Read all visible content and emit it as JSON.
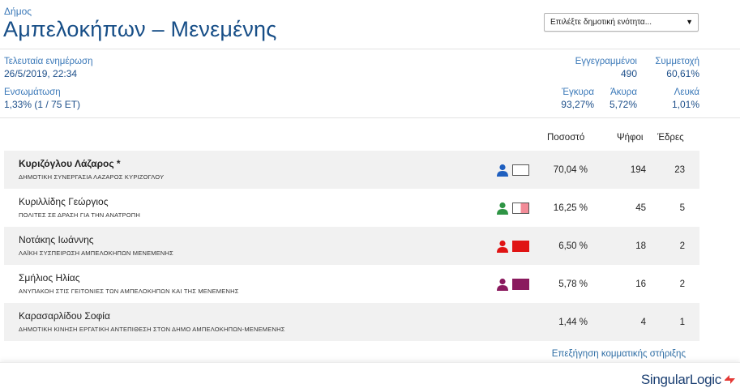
{
  "header": {
    "kicker": "Δήμος",
    "title": "Αμπελοκήπων – Μενεμένης",
    "select": {
      "value": "Επιλέξτε δημοτική ενότητα...",
      "caret": "▼"
    }
  },
  "meta": {
    "updated_label": "Τελευταία ενημέρωση",
    "updated_value": "26/5/2019, 22:34",
    "integration_label": "Ενσωμάτωση",
    "integration_value": "1,33% (1 / 75 ΕΤ)",
    "registered_label": "Εγγεγραμμένοι",
    "registered_value": "490",
    "turnout_label": "Συμμετοχή",
    "turnout_value": "60,61%",
    "valid_label": "Έγκυρα",
    "valid_value": "93,27%",
    "invalid_label": "Άκυρα",
    "invalid_value": "5,72%",
    "blank_label": "Λευκά",
    "blank_value": "1,01%"
  },
  "columns": {
    "percent": "Ποσοστό",
    "votes": "Ψήφοι",
    "seats": "Έδρες"
  },
  "results": [
    {
      "name": "Κυριζόγλου Λάζαρος *",
      "party": "ΔΗΜΟΤΙΚΗ ΣΥΝΕΡΓΑΣΙΑ ΛΑΖΑΡΟΣ ΚΥΡΙΖΟΓΛΟΥ",
      "percent": "70,04 %",
      "votes": "194",
      "seats": "23",
      "person_color": "#1f5fbf",
      "swatch": [
        "#ffffff",
        "#ffffff"
      ],
      "has_icon": true
    },
    {
      "name": "Κυριλλίδης Γεώργιος",
      "party": "ΠΟΛΙΤΕΣ ΣΕ ΔΡΑΣΗ ΓΙΑ ΤΗΝ ΑΝΑΤΡΟΠΗ",
      "percent": "16,25 %",
      "votes": "45",
      "seats": "5",
      "person_color": "#2e9444",
      "swatch": [
        "#ffffff",
        "#f28b97"
      ],
      "has_icon": true
    },
    {
      "name": "Νοτάκης Ιωάννης",
      "party": "ΛΑΪΚΗ ΣΥΣΠΕΙΡΩΣΗ ΑΜΠΕΛΟΚΗΠΩΝ ΜΕΝΕΜΕΝΗΣ",
      "percent": "6,50 %",
      "votes": "18",
      "seats": "2",
      "person_color": "#e01414",
      "swatch": [
        "#e01414",
        "#e01414"
      ],
      "has_icon": true
    },
    {
      "name": "Σμήλιος Ηλίας",
      "party": "ΑΝΥΠΑΚΟΗ ΣΤΙΣ ΓΕΙΤΟΝΙΕΣ ΤΩΝ ΑΜΠΕΛΟΚΗΠΩΝ ΚΑΙ ΤΗΣ ΜΕΝΕΜΕΝΗΣ",
      "percent": "5,78 %",
      "votes": "16",
      "seats": "2",
      "person_color": "#8a1a5e",
      "swatch": [
        "#8a1a5e",
        "#8a1a5e"
      ],
      "has_icon": true
    },
    {
      "name": "Καρασαρλίδου Σοφία",
      "party": "ΔΗΜΟΤΙΚΗ ΚΙΝΗΣΗ ΕΡΓΑΤΙΚΗ ΑΝΤΕΠΙΘΕΣΗ ΣΤΟΝ ΔΗΜΟ ΑΜΠΕΛΟΚΗΠΩΝ-ΜΕΝΕΜΕΝΗΣ",
      "percent": "1,44 %",
      "votes": "4",
      "seats": "1",
      "person_color": "",
      "swatch": [
        "",
        ""
      ],
      "has_icon": false
    }
  ],
  "link": {
    "explain": "Επεξήγηση κομματικής στήριξης"
  },
  "footer": {
    "brand_a": "Singular",
    "brand_b": "Logic"
  },
  "colors": {
    "accent": "#174e87",
    "link": "#2e6da4",
    "row_shade": "#f1f1f1"
  },
  "icons": {
    "candidate": "person-icon",
    "party_color": "party-color-swatch",
    "brand": "singularlogic-logo-icon"
  }
}
